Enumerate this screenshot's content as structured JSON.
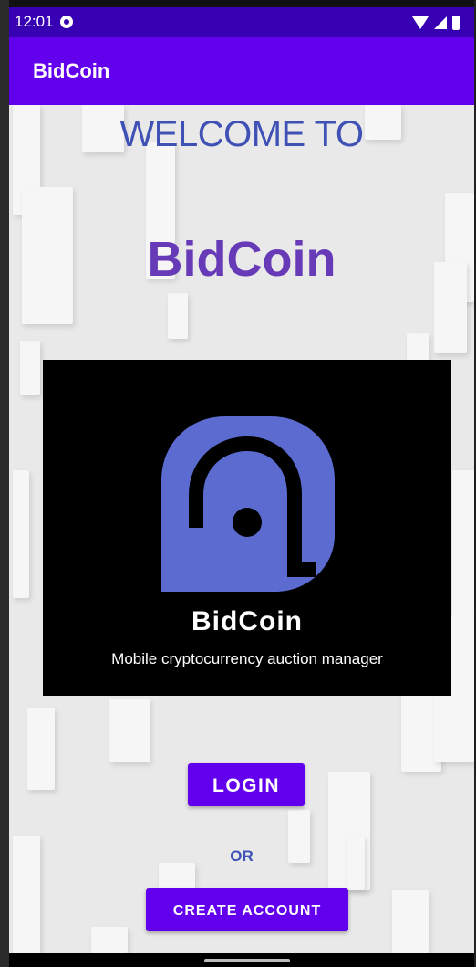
{
  "status_bar": {
    "time": "12:01",
    "notification_icon": "notification-icon",
    "icons": [
      "wifi-icon",
      "signal-icon",
      "battery-icon"
    ],
    "color": "#3700b3"
  },
  "toolbar": {
    "title": "BidCoin",
    "color": "#6200ee"
  },
  "main": {
    "welcome_text": "WELCOME TO",
    "app_name": "BidCoin",
    "logo": {
      "icon": "bidcoin-logo-icon",
      "name": "BidCoin",
      "tagline": "Mobile cryptocurrency auction manager",
      "accent": "#5b6bd0"
    },
    "login_label": "LOGIN",
    "or_label": "OR",
    "create_account_label": "CREATE ACCOUNT"
  },
  "colors": {
    "primary": "#6200ee",
    "primary_dark": "#3700b3",
    "welcome_text": "#3f51b5",
    "title_text": "#673ab7"
  }
}
